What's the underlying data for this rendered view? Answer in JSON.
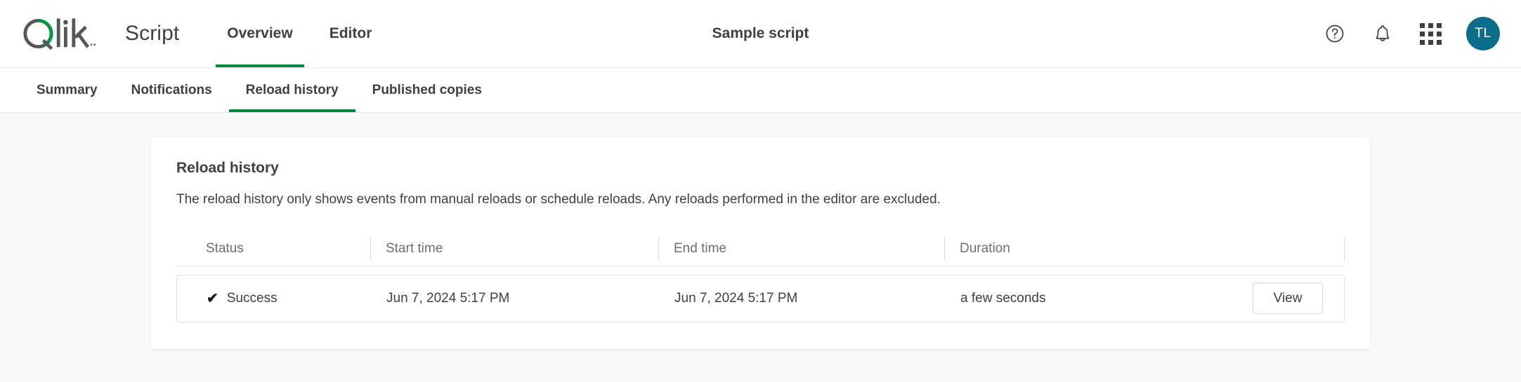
{
  "app_bar": {
    "logo_name": "qlik-logo",
    "product_name": "Script",
    "doc_title": "Sample script",
    "primary_tabs": [
      {
        "label": "Overview",
        "active": true
      },
      {
        "label": "Editor",
        "active": false
      }
    ],
    "actions": [
      {
        "name": "help-icon",
        "label": "?"
      },
      {
        "name": "bell-icon",
        "label": ""
      },
      {
        "name": "apps-grid-icon",
        "label": ""
      }
    ],
    "avatar_initials": "TL",
    "avatar_color": "#0d6e8c"
  },
  "sub_bar": {
    "tabs": [
      {
        "label": "Summary",
        "active": false
      },
      {
        "label": "Notifications",
        "active": false
      },
      {
        "label": "Reload history",
        "active": true
      },
      {
        "label": "Published copies",
        "active": false
      }
    ],
    "accent_color": "#00873d"
  },
  "card": {
    "title": "Reload history",
    "description": "The reload history only shows events from manual reloads or schedule reloads. Any reloads performed in the editor are excluded."
  },
  "table": {
    "columns": [
      "Status",
      "Start time",
      "End time",
      "Duration"
    ],
    "rows": [
      {
        "status_icon": "check-icon",
        "status": "Success",
        "start_time": "Jun 7, 2024 5:17 PM",
        "end_time": "Jun 7, 2024 5:17 PM",
        "duration": "a few seconds",
        "action_label": "View"
      }
    ]
  }
}
